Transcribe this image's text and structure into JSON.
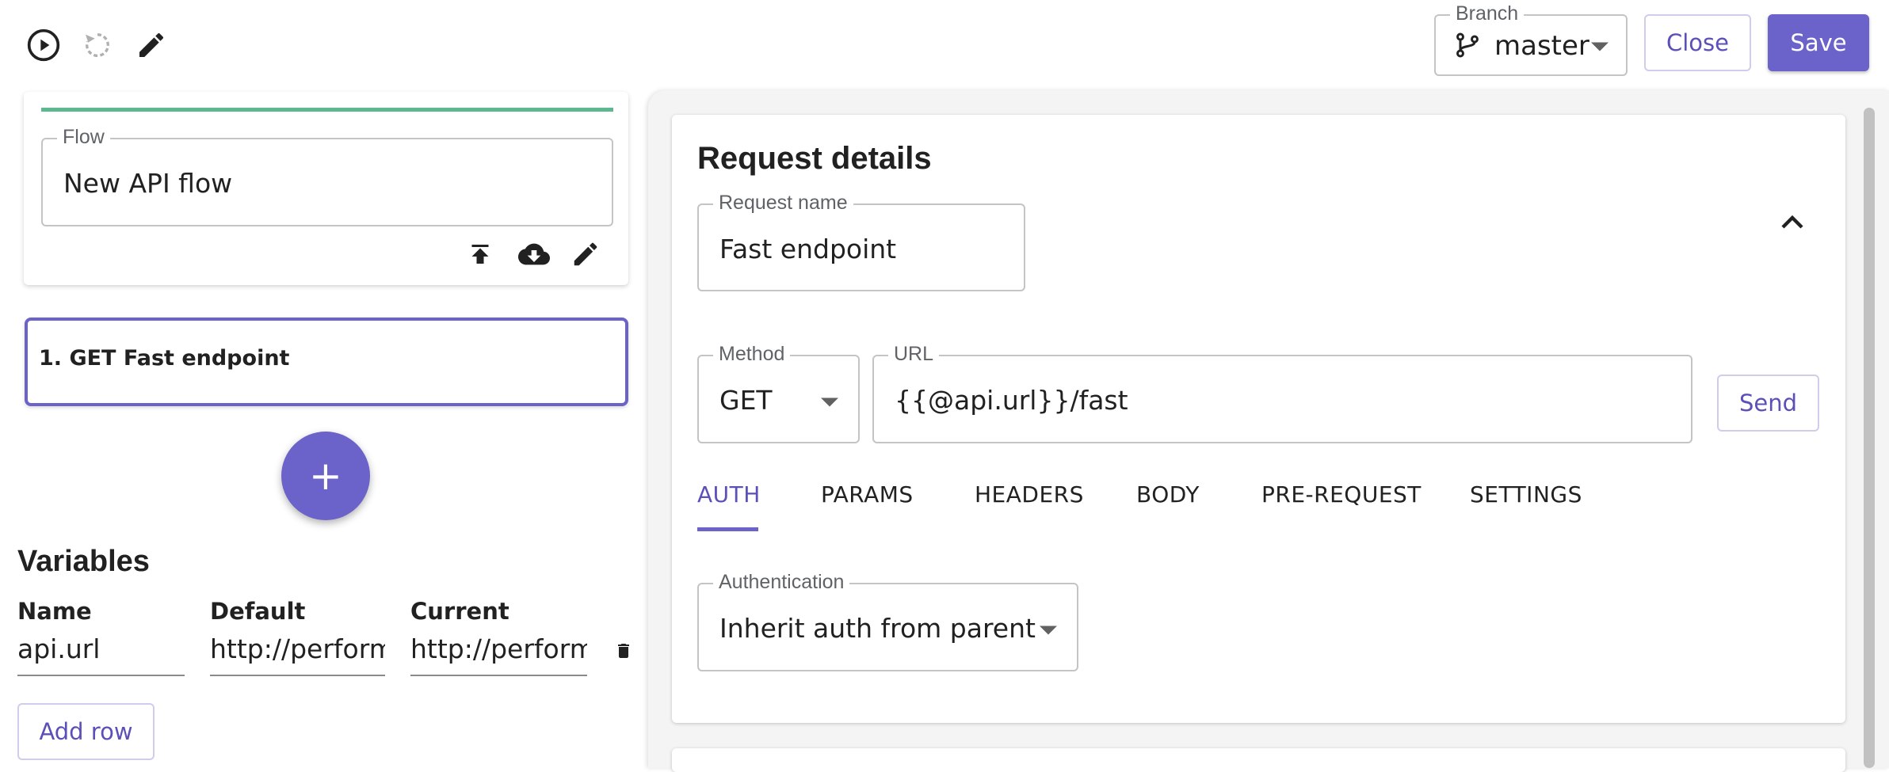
{
  "toolbar": {
    "run_icon": "play-circle-icon",
    "reset_icon": "refresh-icon",
    "edit_icon": "pencil-icon",
    "branch_label": "Branch",
    "branch_value": "master",
    "close_label": "Close",
    "save_label": "Save"
  },
  "flow": {
    "label": "Flow",
    "value": "New API flow",
    "progress_percent": 100
  },
  "steps": [
    {
      "label": "1. GET Fast endpoint"
    }
  ],
  "add_step_symbol": "+",
  "variables": {
    "title": "Variables",
    "columns": [
      "Name",
      "Default",
      "Current"
    ],
    "rows": [
      {
        "name": "api.url",
        "default": "http://performa",
        "current": "http://performa"
      }
    ],
    "add_row_label": "Add row"
  },
  "request": {
    "title": "Request details",
    "name_label": "Request name",
    "name_value": "Fast endpoint",
    "method_label": "Method",
    "method_value": "GET",
    "url_label": "URL",
    "url_value": "{{@api.url}}/fast",
    "send_label": "Send",
    "tabs": [
      "AUTH",
      "PARAMS",
      "HEADERS",
      "BODY",
      "PRE-REQUEST",
      "SETTINGS"
    ],
    "active_tab": "AUTH",
    "auth_label": "Authentication",
    "auth_value": "Inherit auth from parent"
  },
  "colors": {
    "accent": "#6b63c9",
    "progress": "#5cb88f"
  }
}
